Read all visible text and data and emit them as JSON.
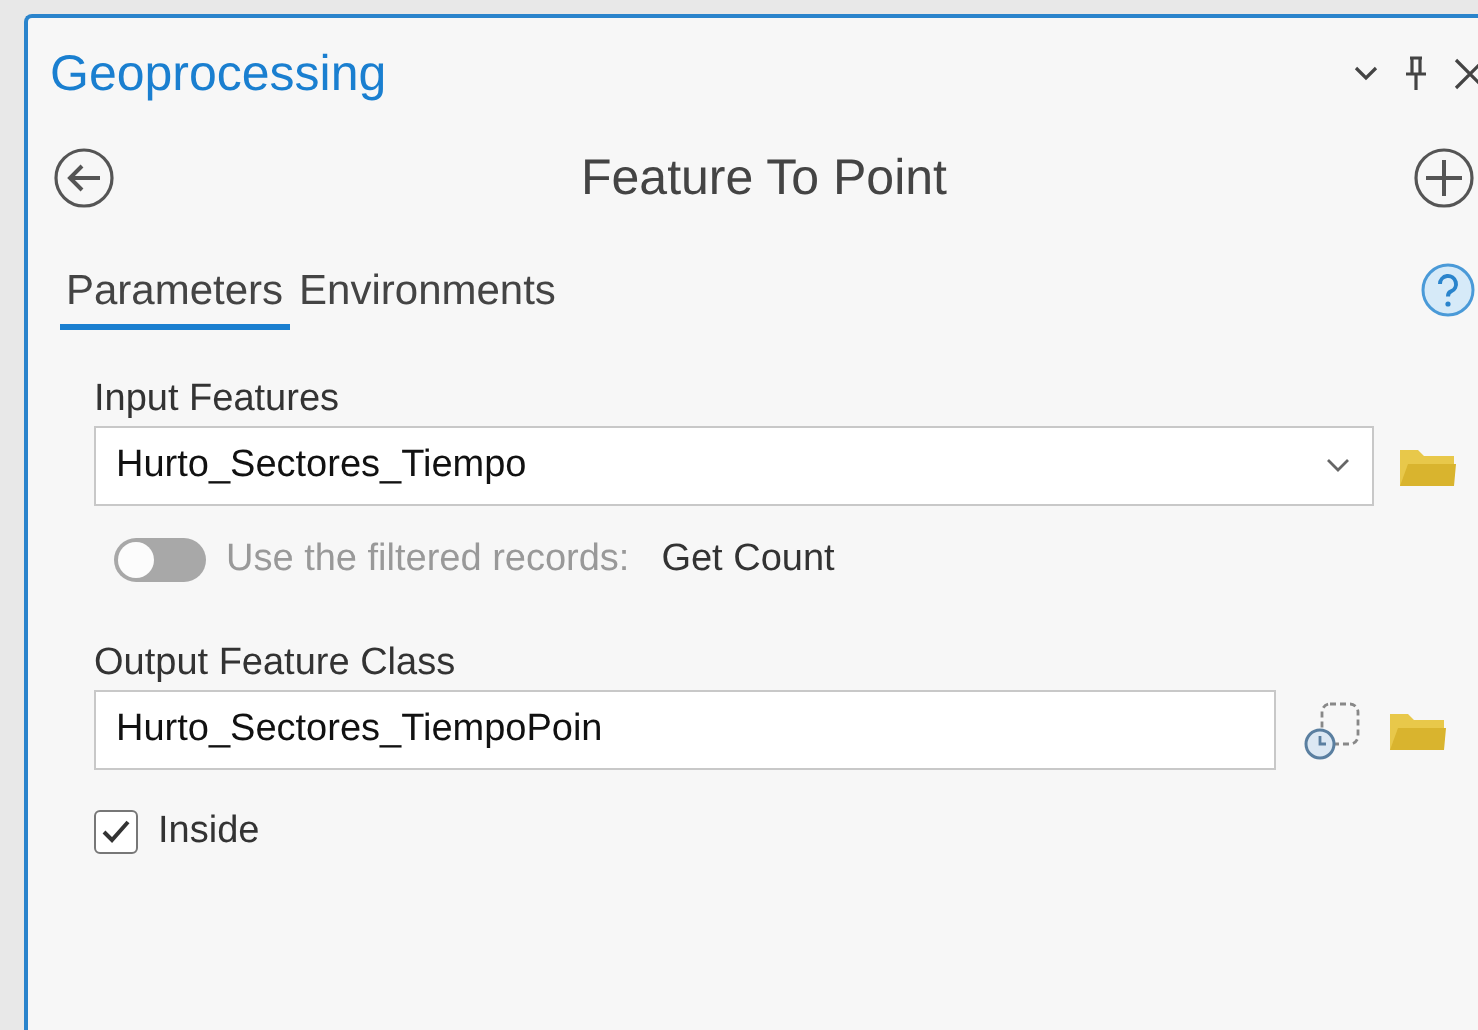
{
  "pane": {
    "title": "Geoprocessing"
  },
  "tool": {
    "title": "Feature To Point"
  },
  "tabs": [
    {
      "label": "Parameters",
      "selected": true
    },
    {
      "label": "Environments",
      "selected": false
    }
  ],
  "input_features": {
    "label": "Input Features",
    "value": "Hurto_Sectores_Tiempo"
  },
  "filter": {
    "label": "Use the filtered records:",
    "on": false,
    "disabled": true,
    "link": "Get Count"
  },
  "output_feature_class": {
    "label": "Output Feature Class",
    "value": "Hurto_Sectores_TiempoPoin"
  },
  "inside": {
    "label": "Inside",
    "checked": true
  }
}
